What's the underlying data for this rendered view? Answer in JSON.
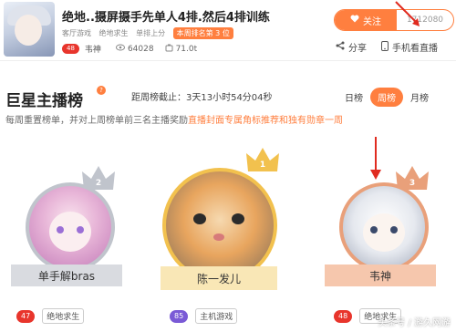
{
  "streamer": {
    "title": "绝地..摄屏摄手先单人4排.然后4排训练",
    "meta": [
      "客厅游戏",
      "绝地求生",
      "单排上分"
    ],
    "rank_badge": "本周排名第 3 位",
    "level": "48",
    "name": "韦神",
    "viewers": "64028",
    "weight": "71.0t"
  },
  "follow": {
    "label": "关注",
    "count": "1712080"
  },
  "actions": {
    "share": "分享",
    "mobile": "手机看直播"
  },
  "board": {
    "title": "巨星主播榜",
    "deadline": "距周榜截止：3天13小时54分04秒",
    "tabs": [
      "日榜",
      "周榜",
      "月榜"
    ],
    "active_tab": "周榜",
    "desc_pre": "每周重置榜单，并对上周榜单前三名主播奖励",
    "desc_hl": "直播封面专属角标推荐和独有勋章一周"
  },
  "ranking": [
    {
      "rank": "2",
      "name": "单手解bras",
      "level": "47",
      "game": "绝地求生",
      "color": "#c0c4cc"
    },
    {
      "rank": "1",
      "name": "陈一发儿",
      "level": "85",
      "game": "主机游戏",
      "color": "#f2c14e"
    },
    {
      "rank": "3",
      "name": "韦神",
      "level": "48",
      "game": "绝地求生",
      "color": "#e9a07a"
    }
  ],
  "watermark": "头条号 / 游久网游",
  "icons": {
    "heart": "heart-icon",
    "share": "share-icon",
    "phone": "phone-icon",
    "eye": "eye-icon",
    "weight": "weight-icon",
    "crown": "crown-icon"
  }
}
